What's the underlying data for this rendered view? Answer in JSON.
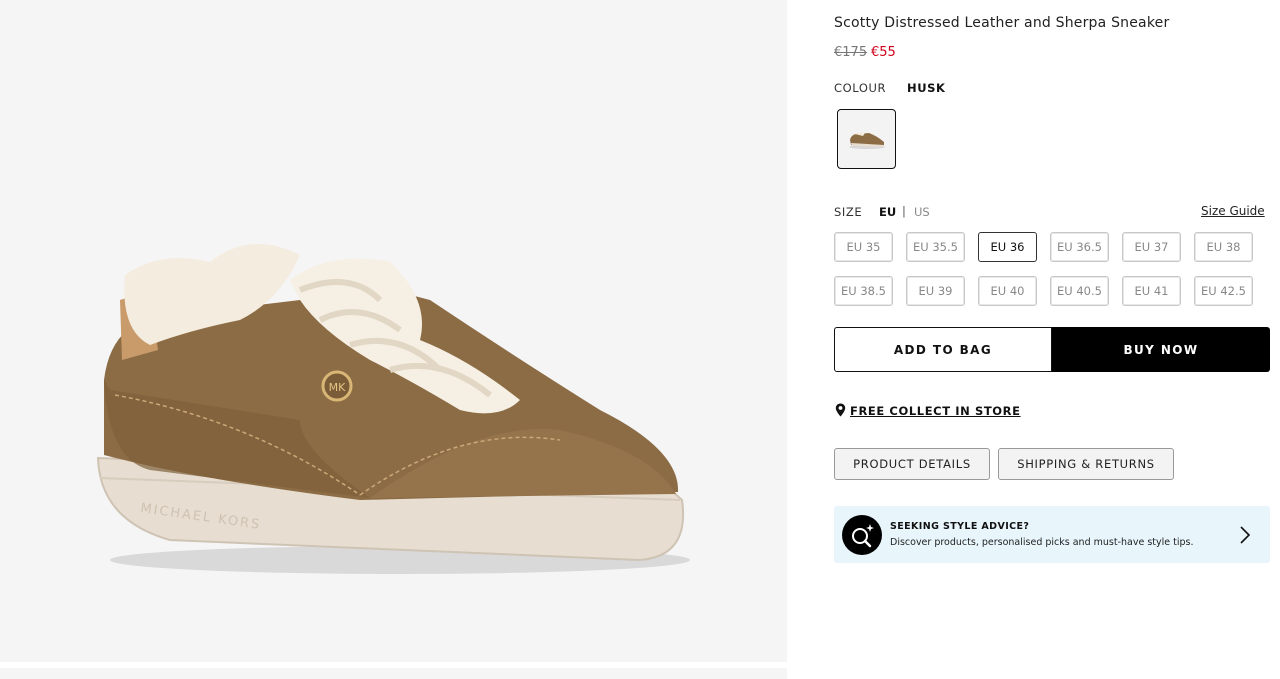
{
  "product": {
    "title": "Scotty Distressed Leather and Sherpa Sneaker",
    "price_original": "€175",
    "price_sale": "€55",
    "shoe_brand_emboss": "MICHAEL KORS",
    "shoe_logo": "MK"
  },
  "colour": {
    "label": "COLOUR",
    "value": "HUSK"
  },
  "size": {
    "label": "SIZE",
    "eu": "EU",
    "separator": "|",
    "us": "US",
    "guide": "Size Guide",
    "options": [
      {
        "label": "EU 35",
        "available": false
      },
      {
        "label": "EU 35.5",
        "available": false
      },
      {
        "label": "EU 36",
        "available": true
      },
      {
        "label": "EU 36.5",
        "available": false
      },
      {
        "label": "EU 37",
        "available": false
      },
      {
        "label": "EU 38",
        "available": false
      },
      {
        "label": "EU 38.5",
        "available": false
      },
      {
        "label": "EU 39",
        "available": false
      },
      {
        "label": "EU 40",
        "available": false
      },
      {
        "label": "EU 40.5",
        "available": false
      },
      {
        "label": "EU 41",
        "available": false
      },
      {
        "label": "EU 42.5",
        "available": false
      }
    ]
  },
  "actions": {
    "add_to_bag": "ADD TO BAG",
    "buy_now": "BUY NOW",
    "collect": "FREE COLLECT IN STORE"
  },
  "tabs": {
    "details": "PRODUCT DETAILS",
    "shipping": "SHIPPING & RETURNS"
  },
  "advice": {
    "title": "SEEKING STYLE ADVICE?",
    "text": "Discover products, personalised picks and must-have style tips."
  },
  "colors": {
    "sale_red": "#d0021b",
    "advice_bg": "#e8f6fc",
    "primary_black": "#000000"
  },
  "icons": [
    "location-pin-icon",
    "style-advice-sparkle-icon",
    "chevron-right-icon"
  ]
}
